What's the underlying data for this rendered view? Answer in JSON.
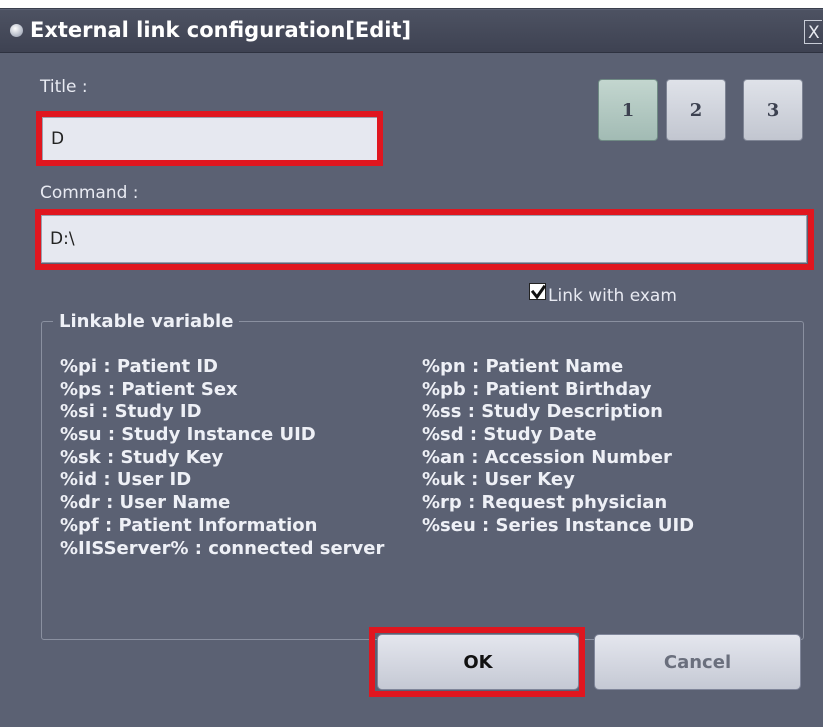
{
  "window": {
    "title": "External link configuration[Edit]",
    "close_glyph": "X"
  },
  "form": {
    "title_label": "Title :",
    "title_value": "D",
    "command_label": "Command :",
    "command_value": "D:\\",
    "link_with_exam_label": "Link with exam",
    "link_with_exam_checked": true
  },
  "pages": [
    {
      "label": "1",
      "active": true
    },
    {
      "label": "2",
      "active": false
    },
    {
      "label": "3",
      "active": false
    }
  ],
  "variables": {
    "legend": "Linkable variable",
    "rows": [
      [
        "%pi : Patient ID",
        "%pn : Patient Name"
      ],
      [
        "%ps : Patient Sex",
        "%pb : Patient Birthday"
      ],
      [
        "%si : Study ID",
        "%ss : Study Description"
      ],
      [
        "%su : Study Instance UID",
        "%sd : Study Date"
      ],
      [
        "%sk : Study Key",
        "%an : Accession Number"
      ],
      [
        "%id : User ID",
        "%uk : User Key"
      ],
      [
        "%dr : User Name",
        "%rp : Request physician"
      ],
      [
        "%pf : Patient Information",
        "%seu : Series Instance UID"
      ],
      [
        "%IISServer% : connected server",
        ""
      ]
    ]
  },
  "buttons": {
    "ok": "OK",
    "cancel": "Cancel"
  },
  "colors": {
    "dialog_bg": "#5b6173",
    "highlight": "#e0161f",
    "active_page": "#a2bbb4",
    "ok_text": "#111111",
    "cancel_text": "#6a6f7d"
  }
}
